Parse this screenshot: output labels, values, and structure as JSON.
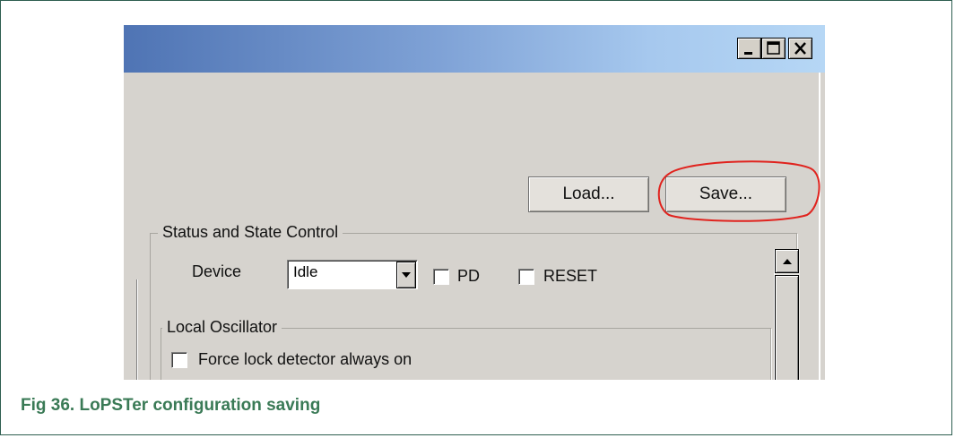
{
  "window": {
    "minimize_label": "_",
    "maximize_label": "□",
    "close_label": "✕"
  },
  "toolbar": {
    "load_label": "Load...",
    "save_label": "Save..."
  },
  "status_group": {
    "title": "Status and State Control",
    "device_label": "Device",
    "device_select_value": "Idle",
    "pd_label": "PD",
    "pd_checked": false,
    "reset_label": "RESET",
    "reset_checked": false
  },
  "oscillator_group": {
    "title": "Local Oscillator",
    "force_lock_label": "Force lock detector always on",
    "force_lock_checked": false
  },
  "annotation": {
    "highlight_color": "#e0231e",
    "highlights": "save-button"
  },
  "caption": {
    "text": "Fig 36.   LoPSTer configuration saving",
    "color": "#3a7a56"
  },
  "colors": {
    "titlebar_start": "#4f74b4",
    "titlebar_end": "#b6d7f5",
    "window_bg": "#d6d3ce",
    "frame_border": "#2e5e50"
  }
}
